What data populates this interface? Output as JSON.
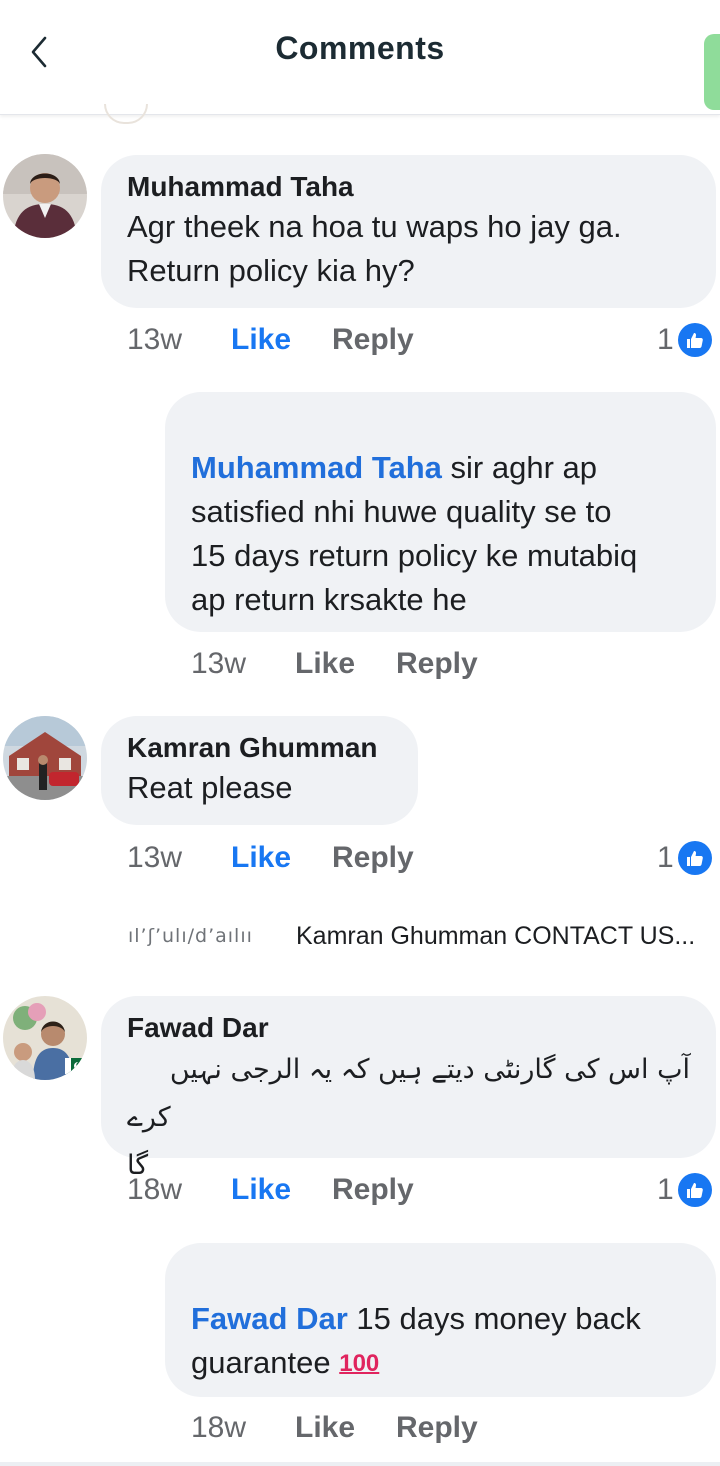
{
  "header": {
    "title": "Comments"
  },
  "colors": {
    "accent": "#1877f2",
    "bubble": "#f0f2f5",
    "meta_text": "#65676b",
    "green_pill": "#8fdc9a"
  },
  "icons": {
    "back": "chevron-left-icon",
    "reaction": "thumbs-up-icon"
  },
  "comments": [
    {
      "author": "Muhammad Taha",
      "lines": [
        "Agr theek na hoa tu waps ho jay ga.",
        "Return policy kia hy?"
      ],
      "time": "13w",
      "like": "Like",
      "reply": "Reply",
      "reactions": "1",
      "reply_item": {
        "mention": "Muhammad Taha",
        "line1": " sir aghr ap",
        "lines": [
          "satisfied nhi huwe quality se to",
          "15 days return policy ke mutabiq",
          "ap return krsakte he"
        ],
        "time": "13w",
        "like": "Like",
        "reply": "Reply"
      }
    },
    {
      "author": "Kamran Ghumman",
      "lines": [
        "Reat please"
      ],
      "time": "13w",
      "like": "Like",
      "reply": "Reply",
      "reactions": "1",
      "preview": {
        "scribble": "ıl’ʃ’ulı/d’aılıı",
        "text": "Kamran Ghumman CONTACT US..."
      }
    },
    {
      "author": "Fawad Dar",
      "lines": [
        "آپ اس کی گارنٹی دیتے ہیں کہ یہ الرجی نہیں",
        "کرے گا"
      ],
      "time": "18w",
      "like": "Like",
      "reply": "Reply",
      "reactions": "1",
      "reply_item": {
        "mention": "Fawad Dar",
        "line1": " 15 days money back",
        "line2": "guarantee ",
        "emoji": "100",
        "time": "18w",
        "like": "Like",
        "reply": "Reply"
      }
    }
  ]
}
